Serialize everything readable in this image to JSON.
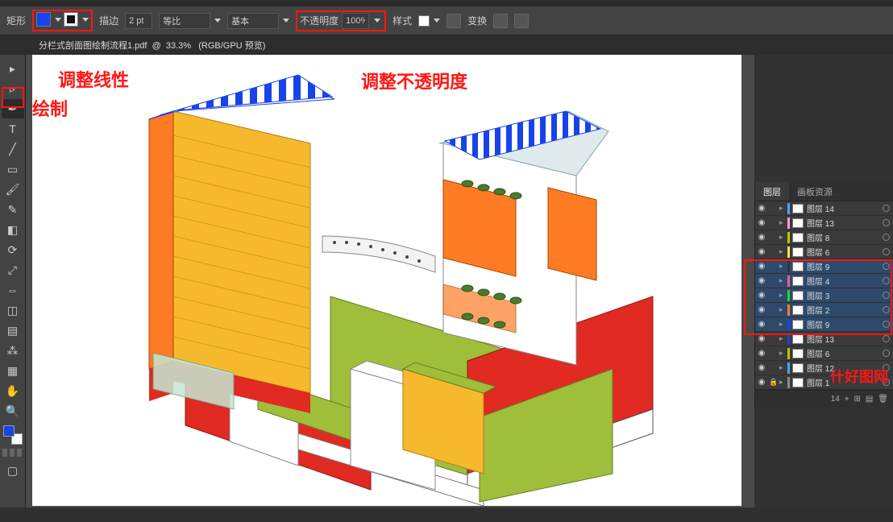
{
  "menubar": {
    "title_prefix": "矩形"
  },
  "optionbar": {
    "fill_color": "#1843e8",
    "stroke_color": "#111111",
    "stroke_label": "描边",
    "stroke_width": "2 pt",
    "stroke_profile": "等比",
    "stroke_type": "基本",
    "opacity_label": "不透明度",
    "opacity_value": "100%",
    "style_label": "样式",
    "transform_label": "变换"
  },
  "document": {
    "tab_title": "分栏式剖面图绘制流程1.pdf",
    "zoom": "33.3%",
    "color_mode": "(RGB/GPU 预览)"
  },
  "annotations": {
    "line_style": "调整线性",
    "opacity": "调整不透明度",
    "draw": "绘制"
  },
  "layers_panel": {
    "tab_layers": "图层",
    "tab_assets": "画板资源",
    "footer_count": "14",
    "items": [
      {
        "name": "图层 14",
        "color": "#4aa3ff",
        "vis": true,
        "sel": false
      },
      {
        "name": "图层 13",
        "color": "#ff9ecf",
        "vis": true,
        "sel": false
      },
      {
        "name": "图层 8",
        "color": "#c6c200",
        "vis": true,
        "sel": false
      },
      {
        "name": "图层 6",
        "color": "#ffe14a",
        "vis": true,
        "sel": false
      },
      {
        "name": "图层 9",
        "color": "#333333",
        "vis": true,
        "sel": true
      },
      {
        "name": "图层 4",
        "color": "#ff59a1",
        "vis": true,
        "sel": true
      },
      {
        "name": "图层 3",
        "color": "#2bd42b",
        "vis": true,
        "sel": true
      },
      {
        "name": "图层 2",
        "color": "#ff7b24",
        "vis": true,
        "sel": true
      },
      {
        "name": "图层 9",
        "color": "#1843e8",
        "vis": true,
        "sel": true
      },
      {
        "name": "图层 13",
        "color": "#1843e8",
        "vis": true,
        "sel": false
      },
      {
        "name": "图层 6",
        "color": "#c6c200",
        "vis": true,
        "sel": false
      },
      {
        "name": "图层 12",
        "color": "#4aa3ff",
        "vis": true,
        "sel": false
      },
      {
        "name": "图层 1",
        "color": "#8a8a8a",
        "vis": true,
        "sel": false,
        "lock": true
      }
    ]
  },
  "watermark": "什好图网",
  "tool_icons": [
    "selection",
    "direct-selection",
    "magic-wand",
    "lasso",
    "pen",
    "curvature",
    "type",
    "line",
    "rectangle",
    "paintbrush",
    "pencil",
    "eraser",
    "rotate",
    "scale",
    "width",
    "free-transform",
    "shape-builder",
    "perspective",
    "mesh",
    "gradient",
    "eyedropper",
    "blend",
    "symbol-sprayer",
    "column-graph",
    "artboard",
    "slice",
    "hand",
    "zoom"
  ]
}
